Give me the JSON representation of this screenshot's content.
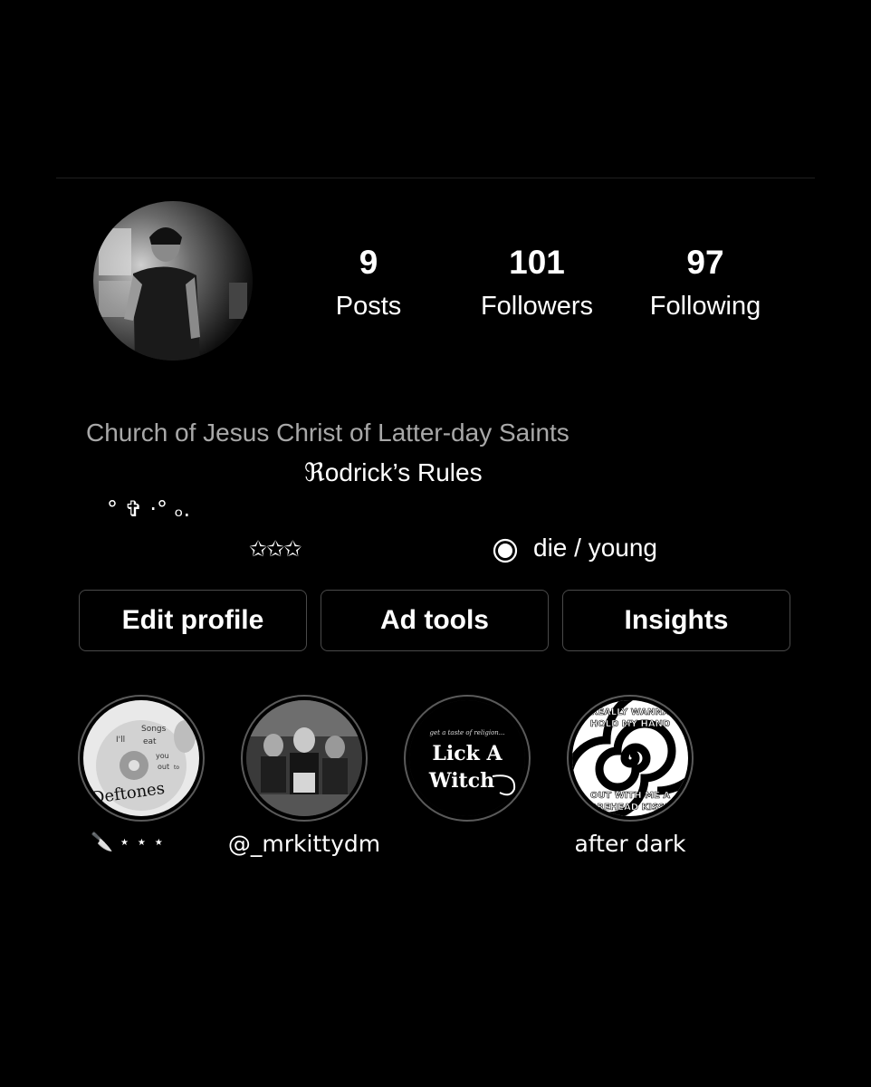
{
  "profile": {
    "stats": {
      "posts": {
        "count": "9",
        "label": "Posts"
      },
      "followers": {
        "count": "101",
        "label": "Followers"
      },
      "following": {
        "count": "97",
        "label": "Following"
      }
    },
    "category": "Church of Jesus Christ of Latter-day Saints",
    "name_first_char": "ℜ",
    "name_rest": "odrick’s Rules",
    "bio_line1": "° ✞ ·° ₒ.",
    "bio_stars": "✩✩✩",
    "bio_link_icon": "record-icon",
    "bio_link_text": "die / young"
  },
  "buttons": {
    "edit_profile": "Edit profile",
    "ad_tools": "Ad tools",
    "insights": "Insights"
  },
  "highlights": [
    {
      "caption": "🔪 ⋆ ⋆ ⋆",
      "cover_text": [
        "Songs",
        "I'll",
        "eat",
        "you",
        "out",
        "to",
        "Deftones"
      ]
    },
    {
      "caption": "@_mrkittydm"
    },
    {
      "caption": "",
      "cover_text": [
        "get a taste of religion...",
        "Lick A",
        "Witch"
      ]
    },
    {
      "caption": "after dark",
      "cover_text": [
        "REALLY WANNA",
        "HOLD MY HAND",
        "OUT WITH ME A",
        "FOREHEAD KISSES"
      ]
    }
  ],
  "colors": {
    "background": "#000000",
    "muted_text": "#a8a8a8",
    "button_border": "#4a4a4a"
  }
}
